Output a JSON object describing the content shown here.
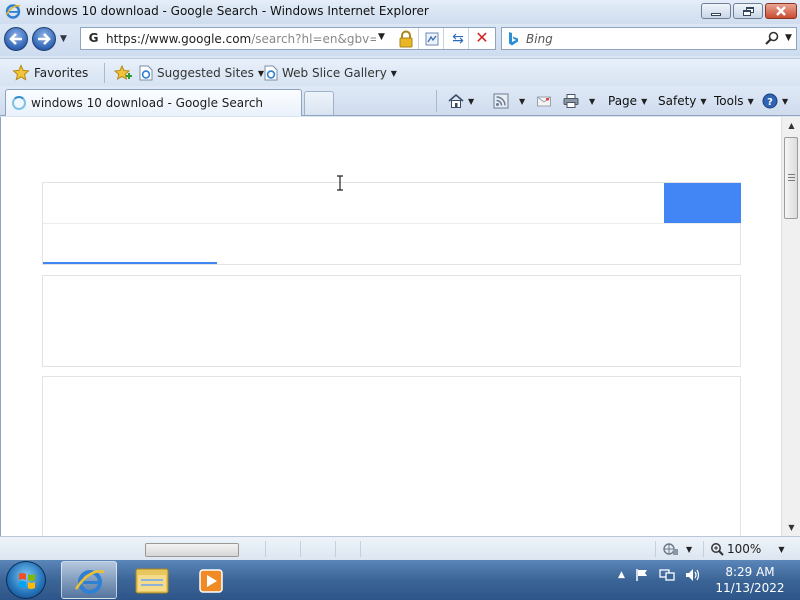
{
  "window": {
    "title": "windows 10 download - Google Search - Windows Internet Explorer"
  },
  "address": {
    "url": "https://www.google.com",
    "url_path": "/search?hl=en&gbv=1&"
  },
  "search_box": {
    "placeholder": "Bing"
  },
  "favorites_bar": {
    "favorites_label": "Favorites",
    "links": [
      "Suggested Sites",
      "Web Slice Gallery"
    ]
  },
  "tab": {
    "label": "windows 10 download - Google Search"
  },
  "command_bar": {
    "page_label": "Page",
    "safety_label": "Safety",
    "tools_label": "Tools"
  },
  "page": {
    "loading_progress_fraction": 0.25
  },
  "status_bar": {
    "zoom": "100%"
  },
  "taskbar": {
    "time": "8:29 AM",
    "date": "11/13/2022"
  },
  "colors": {
    "google_blue": "#4285f4",
    "stop_red": "#d02424"
  }
}
